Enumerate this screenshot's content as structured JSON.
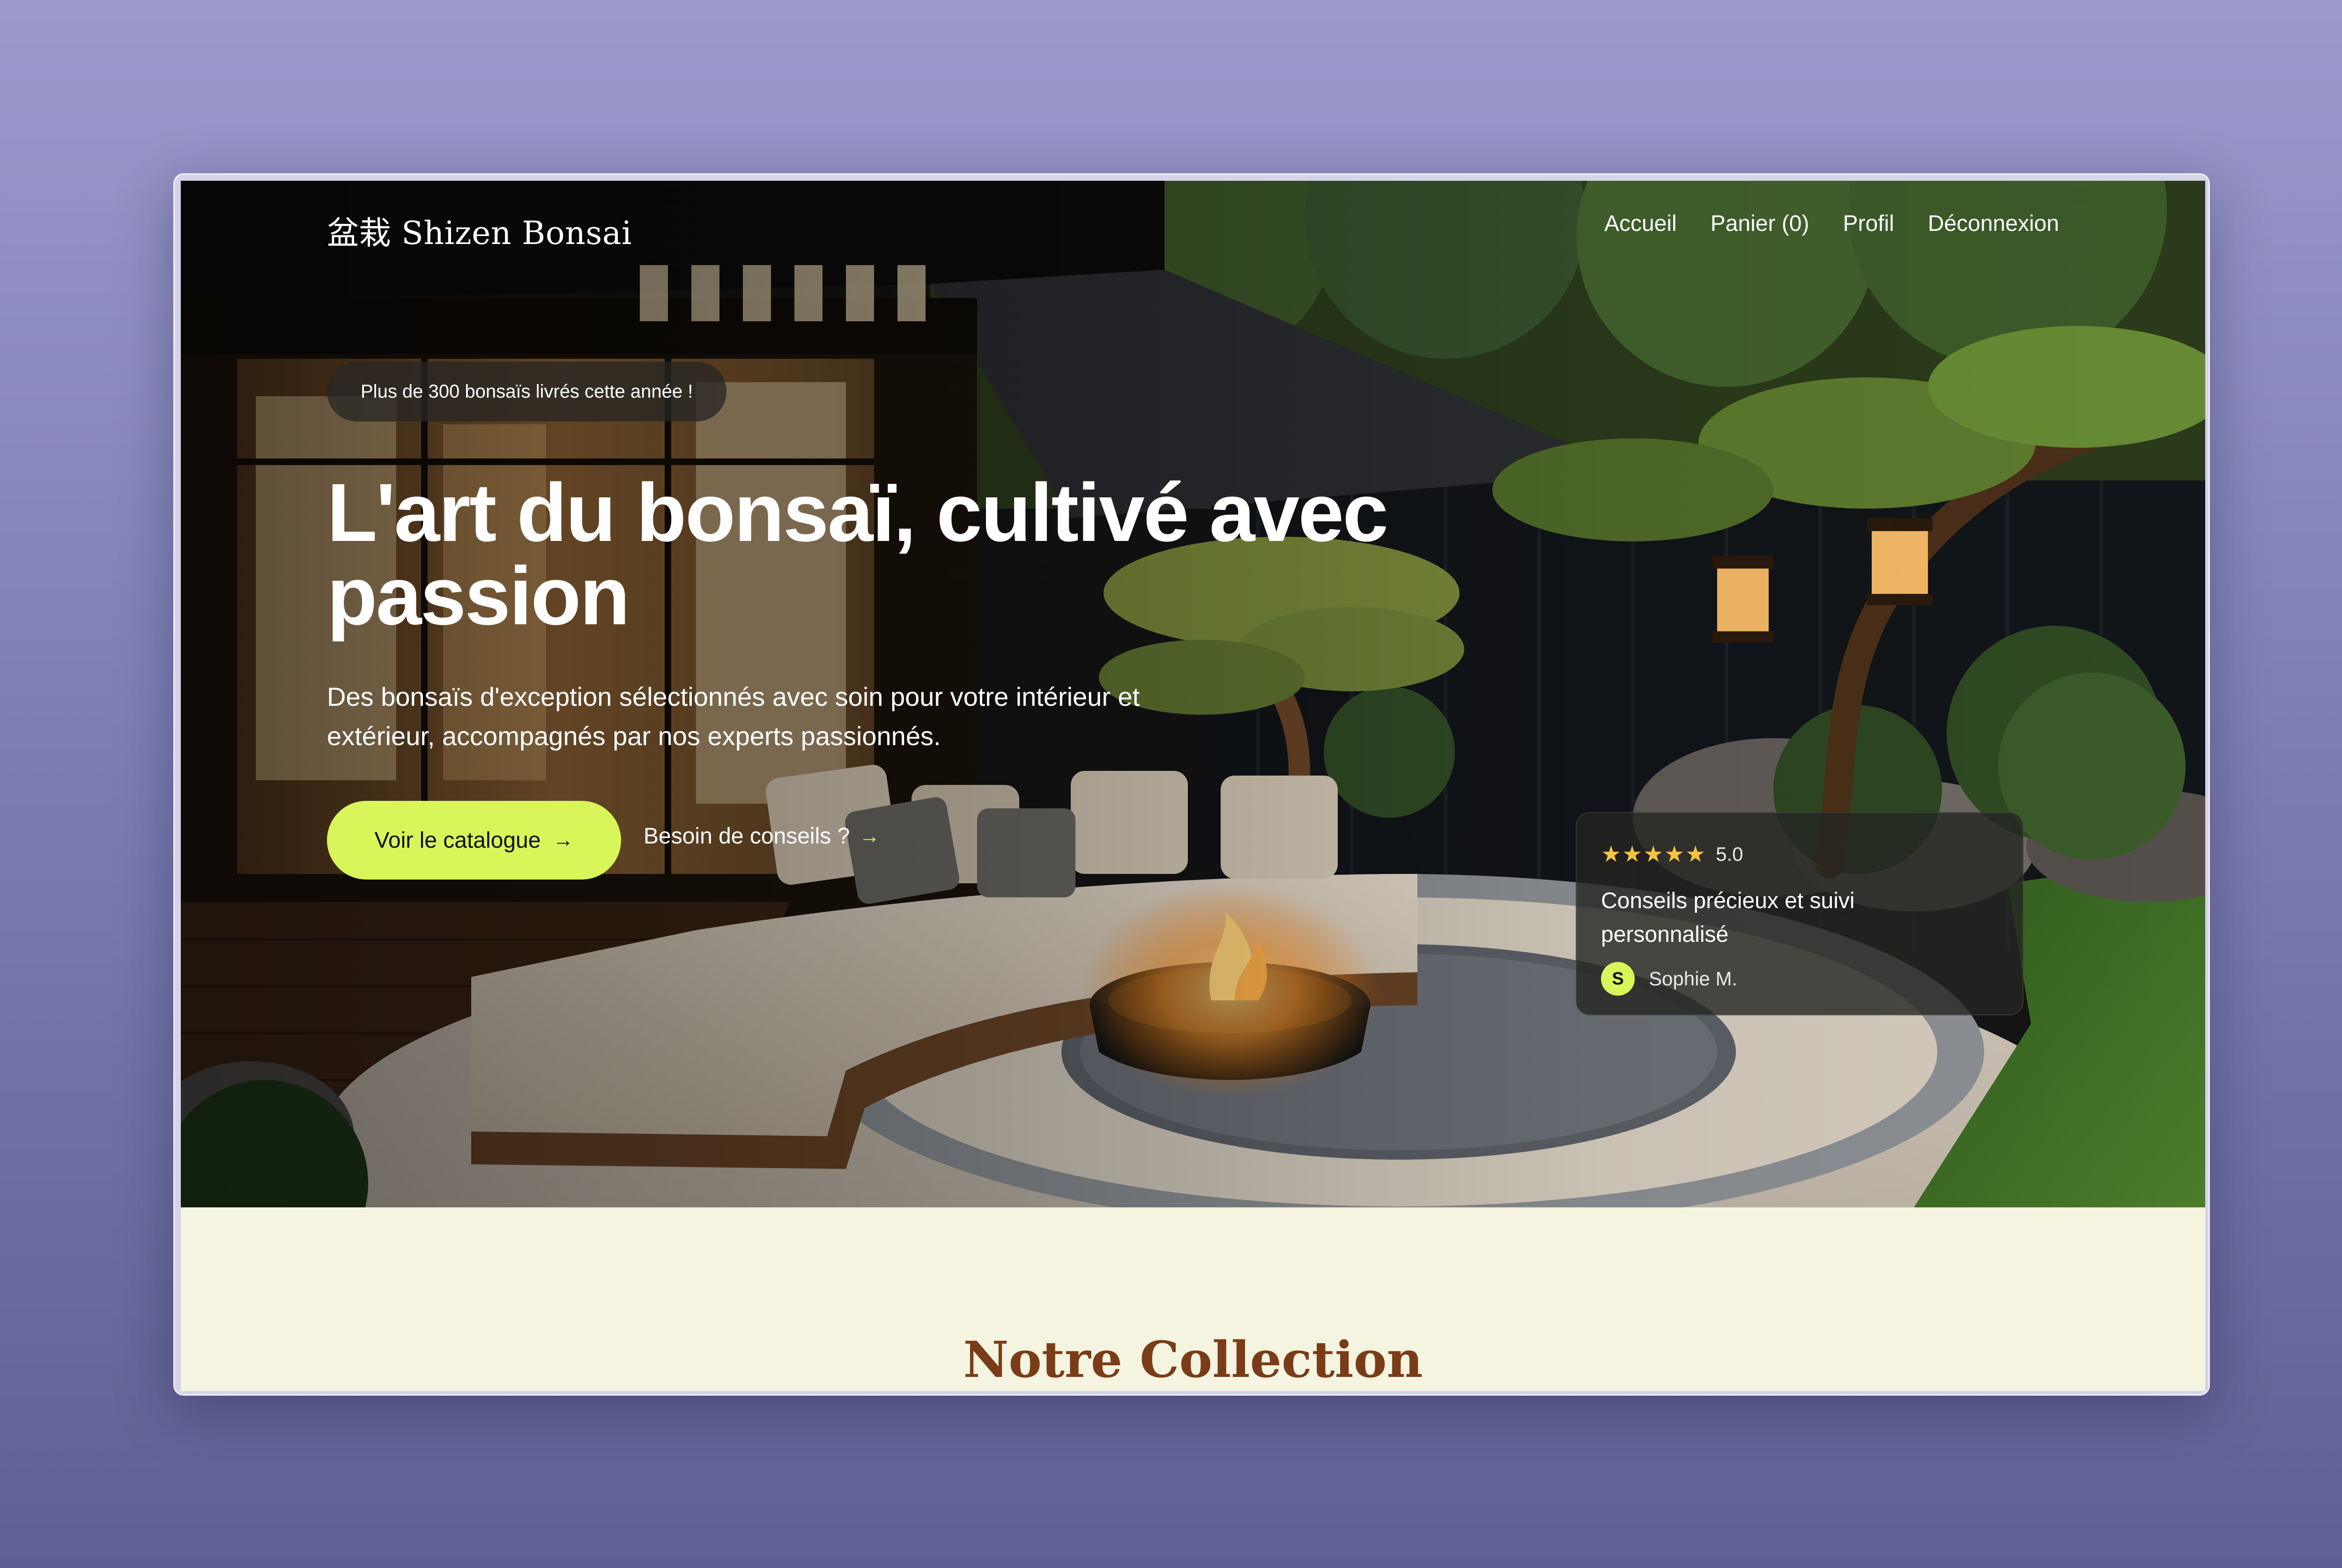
{
  "brand": {
    "name": "盆栽 Shizen Bonsai"
  },
  "nav": {
    "items": [
      {
        "label": "Accueil"
      },
      {
        "label": "Panier (0)"
      },
      {
        "label": "Profil"
      },
      {
        "label": "Déconnexion"
      }
    ]
  },
  "hero": {
    "badge": "Plus de 300 bonsaïs livrés cette année !",
    "title": "L'art du bonsaï, cultivé avec passion",
    "subtitle": "Des bonsaïs d'exception sélectionnés avec soin pour votre intérieur et extérieur, accompagnés par nos experts passionnés.",
    "primary_cta": "Voir le catalogue",
    "secondary_cta": "Besoin de conseils ?",
    "arrow_icon": "→"
  },
  "review": {
    "stars": "★★★★★",
    "rating": "5.0",
    "text": "Conseils précieux et suivi personnalisé",
    "author_initial": "S",
    "author_name": "Sophie M."
  },
  "collection": {
    "title": "Notre Collection"
  },
  "colors": {
    "accent": "#d8f55a",
    "collection_bg": "#f4f4e0",
    "collection_title": "#7a3c18",
    "star": "#f5c542"
  },
  "icons": {
    "arrow": "arrow-right-icon",
    "star": "star-icon"
  }
}
